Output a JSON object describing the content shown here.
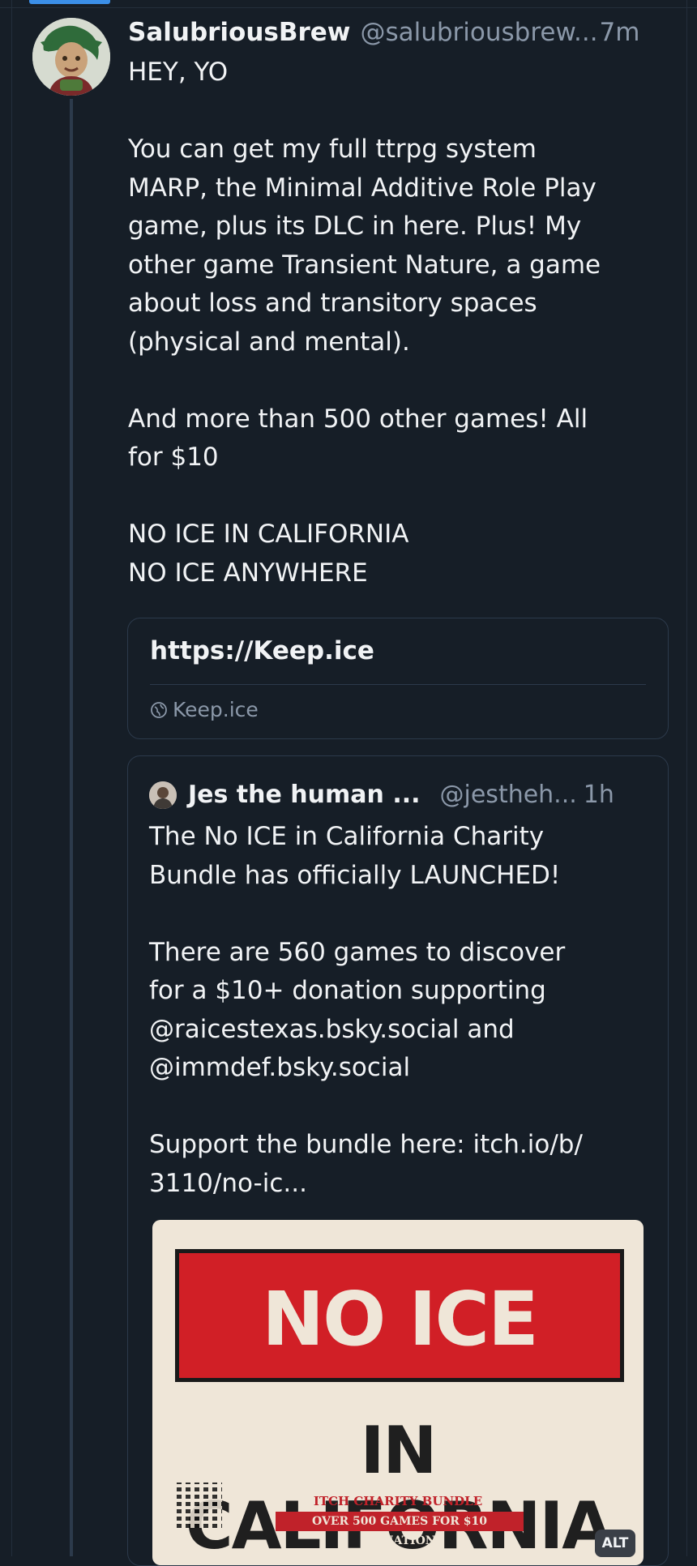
{
  "post": {
    "display_name": "SalubriousBrew",
    "handle": "@salubriousbrew...",
    "time": "7m",
    "text": "HEY, YO\n\nYou can get my full ttrpg system\nMARP, the Minimal Additive Role Play\ngame, plus its DLC in here. Plus! My\nother game Transient Nature, a game\nabout loss and transitory spaces\n(physical and mental).\n\nAnd more than 500 other games! All\nfor $10\n\nNO ICE IN CALIFORNIA\nNO ICE ANYWHERE"
  },
  "link_card": {
    "title": "https://Keep.ice",
    "domain": "Keep.ice",
    "icon": "globe-icon"
  },
  "quote": {
    "display_name": "Jes the human ...",
    "handle": "@jestheh...",
    "time": "1h",
    "text": "The No ICE in California Charity\nBundle has officially LAUNCHED!\n\nThere are 560 games to discover\nfor a $10+ donation supporting\n@raicestexas.bsky.social and\n@immdef.bsky.social\n\nSupport the bundle here: itch.io/b/\n3110/no-ic...",
    "image": {
      "main_text": "NO ICE",
      "sub_text": "IN CALIFORNIA",
      "bundle_line": "ITCH CHARITY BUNDLE",
      "bundle_pill": "OVER 500 GAMES FOR $10 DONATION",
      "alt_label": "ALT"
    }
  },
  "colors": {
    "background": "#161e27",
    "thread_line": "#2c3a4b",
    "accent": "#3b8fe8",
    "sign_red": "#d11f26"
  }
}
